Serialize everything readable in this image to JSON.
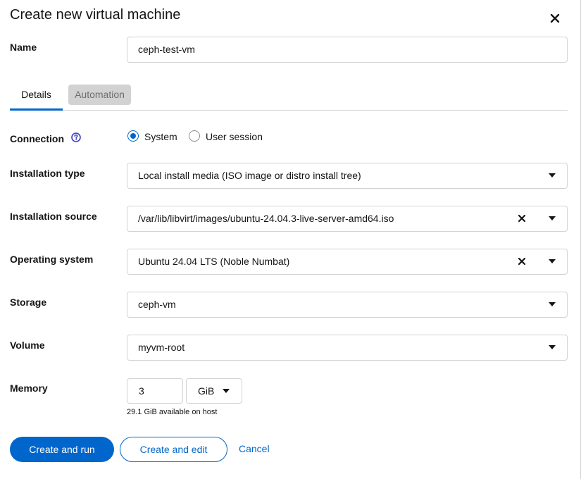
{
  "dialog": {
    "title": "Create new virtual machine",
    "close_icon": "close-icon"
  },
  "name": {
    "label": "Name",
    "value": "ceph-test-vm"
  },
  "tabs": [
    {
      "label": "Details",
      "active": true
    },
    {
      "label": "Automation",
      "active": false
    }
  ],
  "connection": {
    "label": "Connection",
    "help_icon": "question-circle-icon",
    "options": [
      {
        "label": "System",
        "checked": true
      },
      {
        "label": "User session",
        "checked": false
      }
    ]
  },
  "installation_type": {
    "label": "Installation type",
    "value": "Local install media (ISO image or distro install tree)"
  },
  "installation_source": {
    "label": "Installation source",
    "value": "/var/lib/libvirt/images/ubuntu-24.04.3-live-server-amd64.iso"
  },
  "operating_system": {
    "label": "Operating system",
    "value": "Ubuntu 24.04 LTS (Noble Numbat)"
  },
  "storage": {
    "label": "Storage",
    "value": "ceph-vm"
  },
  "volume": {
    "label": "Volume",
    "value": "myvm-root"
  },
  "memory": {
    "label": "Memory",
    "value": "3",
    "unit": "GiB",
    "helper": "29.1 GiB available on host"
  },
  "footer": {
    "primary": "Create and run",
    "secondary": "Create and edit",
    "cancel": "Cancel"
  },
  "colors": {
    "accent": "#0066cc",
    "border": "#d2d2d2"
  }
}
